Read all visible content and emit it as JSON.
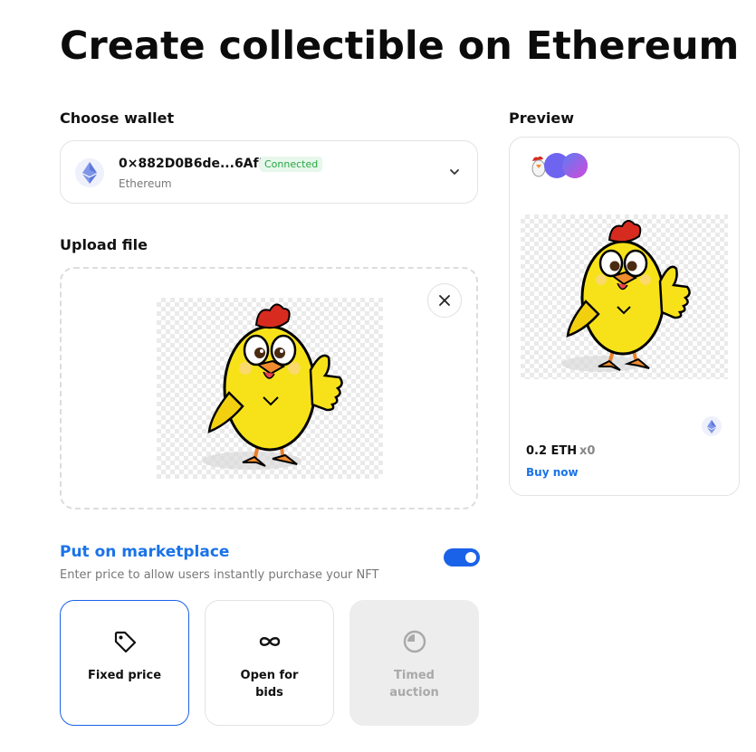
{
  "page": {
    "title": "Create collectible on Ethereum"
  },
  "wallet": {
    "label": "Choose wallet",
    "address": "0×882D0B6de...6AfD",
    "status": "Connected",
    "network": "Ethereum",
    "icon": "ethereum-icon"
  },
  "upload": {
    "label": "Upload file",
    "preview_alt": "Cartoon yellow chick with thumbs up"
  },
  "marketplace": {
    "title": "Put on marketplace",
    "description": "Enter price to allow users instantly purchase your NFT",
    "enabled": true,
    "options": [
      {
        "label": "Fixed price",
        "icon": "tag-icon",
        "selected": true,
        "disabled": false
      },
      {
        "label": "Open for bids",
        "icon": "infinity-icon",
        "selected": false,
        "disabled": false
      },
      {
        "label": "Timed auction",
        "icon": "clock-icon",
        "selected": false,
        "disabled": true
      }
    ]
  },
  "preview": {
    "label": "Preview",
    "price": "0.2 ETH",
    "quantity": "x0",
    "action": "Buy now"
  },
  "colors": {
    "accent": "#1a62e8",
    "link": "#1a73e8",
    "connected": "#27a644"
  }
}
